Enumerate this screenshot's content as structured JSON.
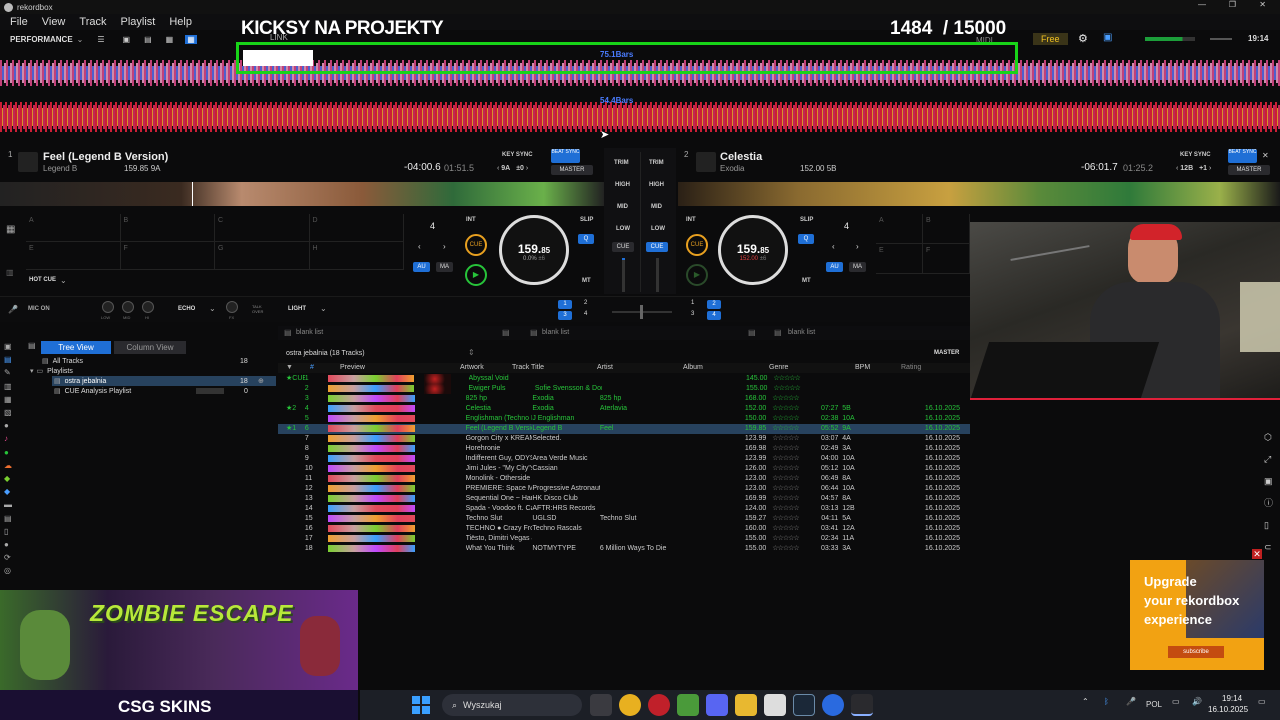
{
  "app": {
    "title": "rekordbox"
  },
  "menu": [
    "File",
    "View",
    "Track",
    "Playlist",
    "Help"
  ],
  "toolbar": {
    "mode": "PERFORMANCE",
    "link": "LINK",
    "midi": "MIDI",
    "free": "Free",
    "clock": "19:14"
  },
  "overlay": {
    "headline": "KICKSY NA PROJEKTY",
    "counter": "1484  / 15000"
  },
  "waveform": {
    "deck1_bars": "75.1Bars",
    "deck2_bars": "54.4Bars"
  },
  "deck1": {
    "num": "1",
    "title": "Feel (Legend B Version)",
    "artist": "Legend B",
    "bpm_key": "159.85 9A",
    "time_remaining": "-04:00.6",
    "time_elapsed": "01:51.5",
    "key_sync": "KEY SYNC",
    "key": "9A",
    "key_shift": "±0",
    "beat_sync": "BEAT SYNC",
    "master": "MASTER",
    "slip": "SLIP",
    "q": "Q",
    "int": "INT",
    "beatjump": "4",
    "bpm_int": "159.",
    "bpm_dec": "85",
    "pitch": "0.0%",
    "range": "±6",
    "cue": "CUE",
    "au": "AU",
    "ma": "MA",
    "mt": "MT",
    "hot_cue": "HOT CUE"
  },
  "deck2": {
    "num": "2",
    "title": "Celestia",
    "artist": "Exodia",
    "bpm_key": "152.00 5B",
    "time_remaining": "-06:01.7",
    "time_elapsed": "01:25.2",
    "key_sync": "KEY SYNC",
    "key": "12B",
    "key_shift": "+1",
    "beat_sync": "BEAT SYNC",
    "master": "MASTER",
    "slip": "SLIP",
    "q": "Q",
    "int": "INT",
    "beatjump": "4",
    "bpm_int": "159.",
    "bpm_dec": "85",
    "pitch": "152.00",
    "range": "±6",
    "cue": "CUE",
    "au": "AU",
    "ma": "MA",
    "mt": "MT"
  },
  "pads": {
    "left": [
      "A",
      "B",
      "C",
      "D",
      "E",
      "F",
      "G",
      "H"
    ],
    "right": [
      "A",
      "B",
      "C",
      "D"
    ]
  },
  "mixer": {
    "trim": "TRIM",
    "high": "HIGH",
    "mid": "MID",
    "low": "LOW",
    "cue": "CUE"
  },
  "fx": {
    "mic": "MIC ON",
    "low": "LOW",
    "mid": "MID",
    "hi": "HI",
    "fx": "FX",
    "talk": "TALK OVER",
    "echo": "ECHO",
    "light": "LIGHT",
    "deck_nums": [
      "1",
      "2",
      "3",
      "4"
    ]
  },
  "panels": {
    "blank1": "blank list",
    "blank2": "blank list",
    "blank3": "blank list"
  },
  "tree": {
    "tab_tree": "Tree View",
    "tab_column": "Column View",
    "items": [
      {
        "label": "All Tracks",
        "count": "18"
      },
      {
        "label": "Playlists",
        "count": ""
      },
      {
        "label": "ostra jebalnia",
        "count": "18"
      },
      {
        "label": "CUE Analysis Playlist",
        "count": "0"
      }
    ]
  },
  "playlist": {
    "title": "ostra jebalnia (18 Tracks)",
    "master": "MASTER"
  },
  "columns": {
    "num": "#",
    "preview": "Preview",
    "artwork": "Artwork",
    "title": "Track Title",
    "artist": "Artist",
    "album": "Album",
    "genre": "Genre",
    "bpm": "BPM",
    "rating": "Rating"
  },
  "tracks": [
    {
      "n": "1",
      "idx": "★CUE",
      "title": "Abyssal Void",
      "artist": "",
      "album": "",
      "bpm": "145.00",
      "time": "",
      "key": "",
      "date": "",
      "hl": true
    },
    {
      "n": "2",
      "idx": "",
      "title": "Ewiger Puls",
      "artist": "Sofie Svensson & Dom",
      "album": "",
      "bpm": "155.00",
      "time": "",
      "key": "",
      "date": "",
      "hl": true
    },
    {
      "n": "3",
      "idx": "",
      "title": "825 hp",
      "artist": "Exodia",
      "album": "825 hp",
      "bpm": "168.00",
      "time": "",
      "key": "",
      "date": "",
      "hl": true
    },
    {
      "n": "4",
      "idx": "★2",
      "title": "Celestia",
      "artist": "Exodia",
      "album": "Aterlavia",
      "bpm": "152.00",
      "time": "07:27",
      "key": "5B",
      "date": "16.10.2025",
      "hl": true
    },
    {
      "n": "5",
      "idx": "",
      "title": "Englishman (Techno Re",
      "artist": "J Englishman",
      "album": "",
      "bpm": "150.00",
      "time": "02:38",
      "key": "10A",
      "date": "16.10.2025",
      "hl": true
    },
    {
      "n": "6",
      "idx": "★1",
      "title": "Feel (Legend B Version)",
      "artist": "Legend B",
      "album": "Feel",
      "bpm": "159.85",
      "time": "05:52",
      "key": "9A",
      "date": "16.10.2025",
      "hl": true,
      "sel": true
    },
    {
      "n": "7",
      "idx": "",
      "title": "Gorgon City x KREAM x",
      "artist": "Selected.",
      "album": "",
      "bpm": "123.99",
      "time": "03:07",
      "key": "4A",
      "date": "16.10.2025"
    },
    {
      "n": "8",
      "idx": "",
      "title": "Horehronie",
      "artist": "",
      "album": "",
      "bpm": "169.98",
      "time": "02:49",
      "key": "3A",
      "date": "16.10.2025"
    },
    {
      "n": "9",
      "idx": "",
      "title": "Indifferent Guy, ODYSS",
      "artist": "Area Verde Music",
      "album": "",
      "bpm": "123.99",
      "time": "04:00",
      "key": "10A",
      "date": "16.10.2025"
    },
    {
      "n": "10",
      "idx": "",
      "title": "Jimi Jules - \"My City\"s",
      "artist": "Cassian",
      "album": "",
      "bpm": "126.00",
      "time": "05:12",
      "key": "10A",
      "date": "16.10.2025"
    },
    {
      "n": "11",
      "idx": "",
      "title": "Monolink - Otherside (Fi",
      "artist": "",
      "album": "",
      "bpm": "123.00",
      "time": "06:49",
      "key": "8A",
      "date": "16.10.2025"
    },
    {
      "n": "12",
      "idx": "",
      "title": "PREMIERE: Space Moti",
      "artist": "Progressive Astronaut",
      "album": "",
      "bpm": "123.00",
      "time": "06:44",
      "key": "10A",
      "date": "16.10.2025"
    },
    {
      "n": "13",
      "idx": "",
      "title": "Sequential One ~ Hands",
      "artist": "HK Disco Club",
      "album": "",
      "bpm": "169.99",
      "time": "04:57",
      "key": "8A",
      "date": "16.10.2025"
    },
    {
      "n": "14",
      "idx": "",
      "title": "Spada - Voodoo ft. Cam",
      "artist": "AFTR:HRS Records",
      "album": "",
      "bpm": "124.00",
      "time": "03:13",
      "key": "12B",
      "date": "16.10.2025"
    },
    {
      "n": "15",
      "idx": "",
      "title": "Techno Slut",
      "artist": "UGLSD",
      "album": "Techno Slut",
      "bpm": "159.27",
      "time": "04:11",
      "key": "5A",
      "date": "16.10.2025"
    },
    {
      "n": "16",
      "idx": "",
      "title": "TECHNO ● Crazy Frog",
      "artist": "Techno Rascals",
      "album": "",
      "bpm": "160.00",
      "time": "03:41",
      "key": "12A",
      "date": "16.10.2025"
    },
    {
      "n": "17",
      "idx": "",
      "title": "Tiësto, Dimitri Vegas & L",
      "artist": "",
      "album": "",
      "bpm": "155.00",
      "time": "02:34",
      "key": "11A",
      "date": "16.10.2025"
    },
    {
      "n": "18",
      "idx": "",
      "title": "What You Think",
      "artist": "NOTMYTYPE",
      "album": "6 Million Ways To Die",
      "bpm": "155.00",
      "time": "03:33",
      "key": "3A",
      "date": "16.10.2025"
    }
  ],
  "stars": "☆☆☆☆☆",
  "ad": {
    "line1": "Upgrade",
    "line2": "your rekordbox",
    "line3": "experience",
    "button": "subscribe"
  },
  "zombie": {
    "title": "ZOMBIE ESCAPE",
    "brand": "CSG SKINS"
  },
  "taskbar": {
    "search": "Wyszukaj",
    "lang": "POL",
    "time": "19:14",
    "date": "16.10.2025"
  },
  "colors": {
    "accent": "#1f6fd6",
    "green": "#27c43a",
    "overlay_border": "#18d418"
  }
}
